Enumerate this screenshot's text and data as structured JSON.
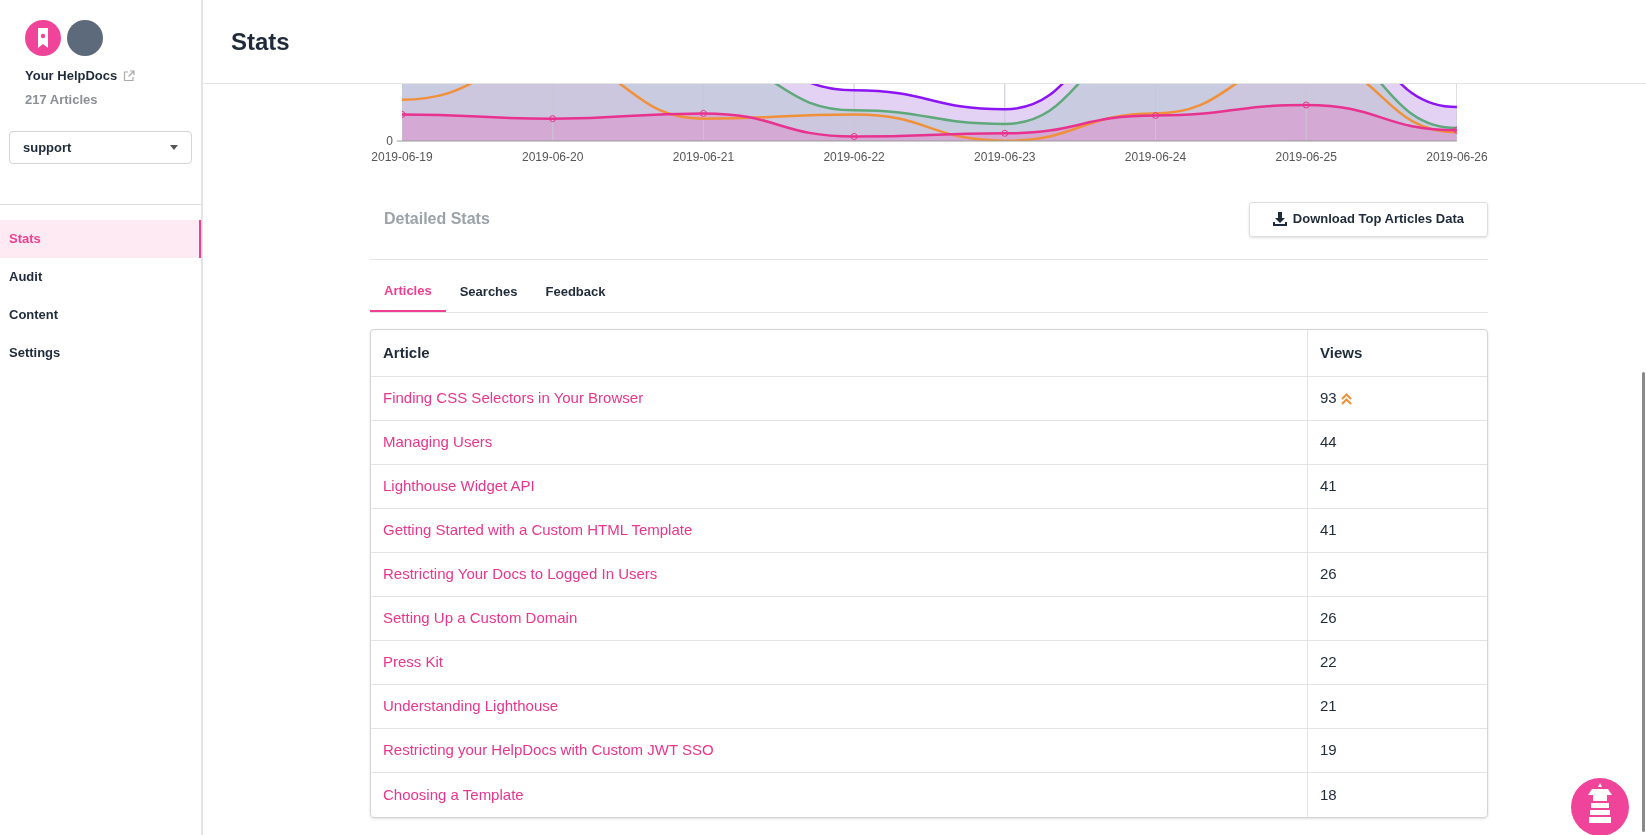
{
  "sidebar": {
    "site_name": "Your HelpDocs",
    "article_count": "217 Articles",
    "dropdown": {
      "value": "support"
    },
    "nav": [
      {
        "label": "Stats",
        "selected": true
      },
      {
        "label": "Audit",
        "selected": false
      },
      {
        "label": "Content",
        "selected": false
      },
      {
        "label": "Settings",
        "selected": false
      }
    ]
  },
  "header": {
    "title": "Stats"
  },
  "chart": {
    "y_tick": "0",
    "x_labels": [
      "2019-06-19",
      "2019-06-20",
      "2019-06-21",
      "2019-06-22",
      "2019-06-23",
      "2019-06-24",
      "2019-06-25",
      "2019-06-26"
    ]
  },
  "detailed": {
    "title": "Detailed Stats",
    "download_button": "Download Top Articles Data",
    "tabs": [
      {
        "label": "Articles",
        "selected": true
      },
      {
        "label": "Searches",
        "selected": false
      },
      {
        "label": "Feedback",
        "selected": false
      }
    ]
  },
  "table": {
    "columns": [
      "Article",
      "Views"
    ],
    "rows": [
      {
        "article": "Finding CSS Selectors in Your Browser",
        "views": "93",
        "trending": true
      },
      {
        "article": "Managing Users",
        "views": "44",
        "trending": false
      },
      {
        "article": "Lighthouse Widget API",
        "views": "41",
        "trending": false
      },
      {
        "article": "Getting Started with a Custom HTML Template",
        "views": "41",
        "trending": false
      },
      {
        "article": "Restricting Your Docs to Logged In Users",
        "views": "26",
        "trending": false
      },
      {
        "article": "Setting Up a Custom Domain",
        "views": "26",
        "trending": false
      },
      {
        "article": "Press Kit",
        "views": "22",
        "trending": false
      },
      {
        "article": "Understanding Lighthouse",
        "views": "21",
        "trending": false
      },
      {
        "article": "Restricting your HelpDocs with Custom JWT SSO",
        "views": "19",
        "trending": false
      },
      {
        "article": "Choosing a Template",
        "views": "18",
        "trending": false
      }
    ]
  }
}
